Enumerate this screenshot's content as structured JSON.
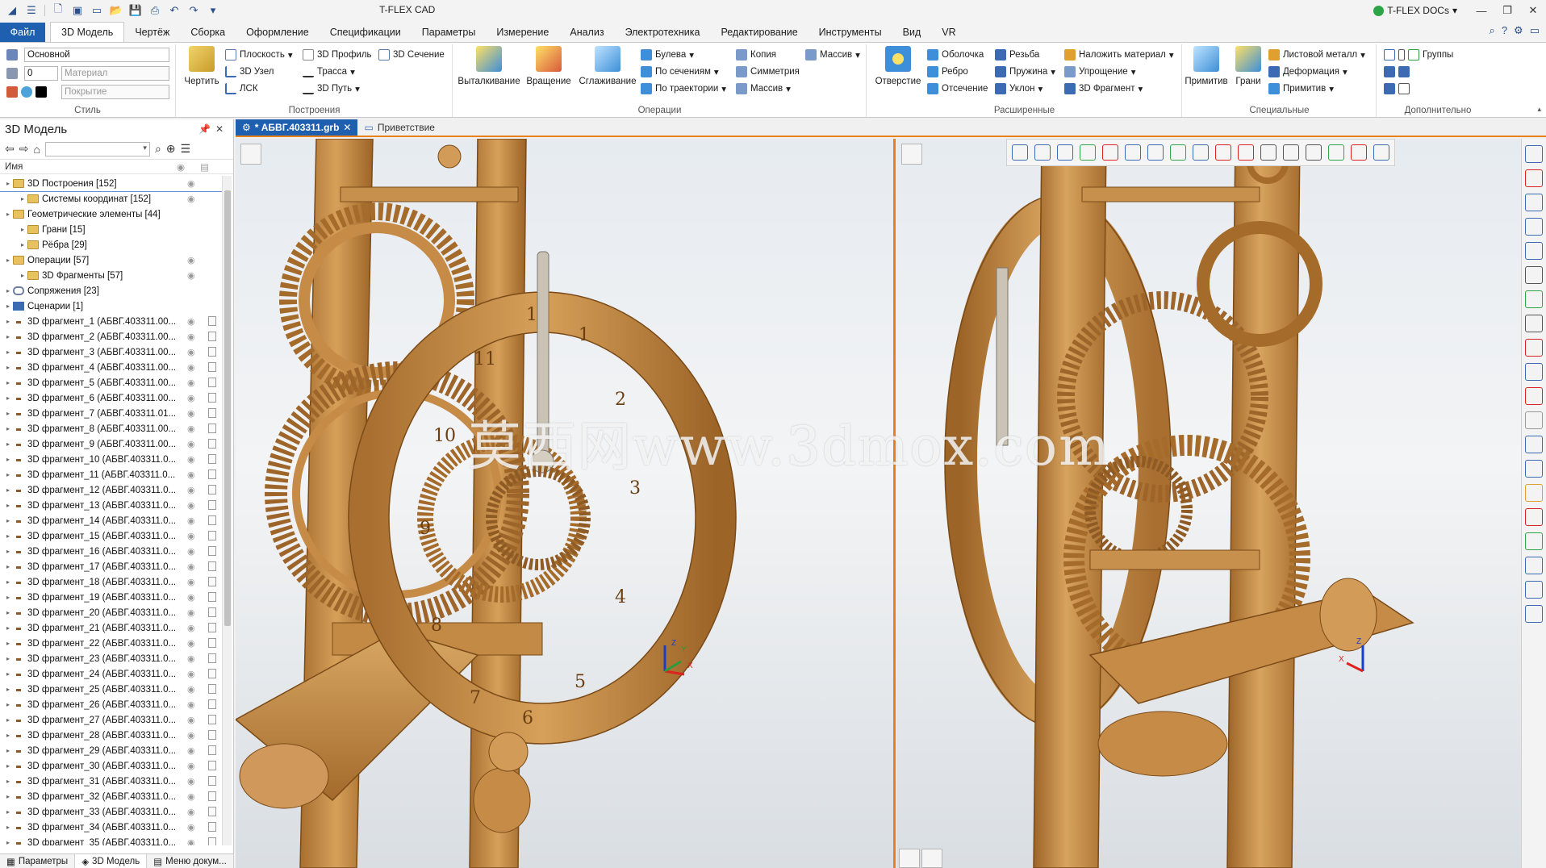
{
  "app": {
    "title": "T-FLEX CAD",
    "docs_label": "T-FLEX DOCs",
    "window_buttons": [
      "—",
      "❐",
      "✕"
    ]
  },
  "tabs": {
    "file": "Файл",
    "items": [
      "3D Модель",
      "Чертёж",
      "Сборка",
      "Оформление",
      "Спецификации",
      "Параметры",
      "Измерение",
      "Анализ",
      "Электротехника",
      "Редактирование",
      "Инструменты",
      "Вид",
      "VR"
    ]
  },
  "ribbon": {
    "style": {
      "label": "Стиль",
      "layer": "Основной",
      "level": "0",
      "material_placeholder": "Материал",
      "coating_placeholder": "Покрытие"
    },
    "build": {
      "label": "Построения",
      "draw": "Чертить",
      "plane": "Плоскость",
      "node3d": "3D Узел",
      "lsk": "ЛСК",
      "profile3d": "3D Профиль",
      "trace": "Трасса",
      "path3d": "3D Путь",
      "section3d": "3D Сечение"
    },
    "operations": {
      "label": "Операции",
      "extrude": "Выталкивание",
      "revolve": "Вращение",
      "smooth": "Сглаживание",
      "boolean": "Булева",
      "by_sections": "По сечениям",
      "by_trajectory": "По траектории",
      "copy": "Копия",
      "symmetry": "Симметрия",
      "array": "Массив",
      "array2": "Массив"
    },
    "advanced": {
      "label": "Расширенные",
      "hole": "Отверстие",
      "shell": "Оболочка",
      "rib": "Ребро",
      "cut": "Отсечение",
      "thread": "Резьба",
      "spring": "Пружина",
      "draft": "Уклон",
      "apply_material": "Наложить материал",
      "simplify": "Упрощение",
      "fragment3d": "3D Фрагмент"
    },
    "special": {
      "label": "Специальные",
      "primitive": "Примитив",
      "faces": "Грани",
      "sheet_metal": "Листовой металл",
      "deform": "Деформация",
      "primitive2": "Примитив"
    },
    "extra": {
      "label": "Дополнительно",
      "groups": "Группы"
    }
  },
  "left_panel": {
    "title": "3D Модель",
    "column_name": "Имя",
    "tree": [
      {
        "label": "3D Построения [152]",
        "level": 0,
        "icon": "folder",
        "eye": true,
        "selected": true
      },
      {
        "label": "Системы координат [152]",
        "level": 1,
        "icon": "folder",
        "eye": true
      },
      {
        "label": "Геометрические элементы [44]",
        "level": 0,
        "icon": "folder",
        "eye": false
      },
      {
        "label": "Грани [15]",
        "level": 1,
        "icon": "folder",
        "eye": false
      },
      {
        "label": "Рёбра [29]",
        "level": 1,
        "icon": "folder",
        "eye": false
      },
      {
        "label": "Операции [57]",
        "level": 0,
        "icon": "folder",
        "eye": true
      },
      {
        "label": "3D Фрагменты [57]",
        "level": 1,
        "icon": "folder",
        "eye": true
      },
      {
        "label": "Сопряжения [23]",
        "level": 0,
        "icon": "chain",
        "eye": false
      },
      {
        "label": "Сценарии [1]",
        "level": 0,
        "icon": "grid",
        "eye": false
      },
      {
        "label": "3D фрагмент_1 (АБВГ.403311.00...",
        "level": 0,
        "icon": "frag",
        "eye": true
      },
      {
        "label": "3D фрагмент_2 (АБВГ.403311.00...",
        "level": 0,
        "icon": "frag",
        "eye": true
      },
      {
        "label": "3D фрагмент_3 (АБВГ.403311.00...",
        "level": 0,
        "icon": "frag",
        "eye": true
      },
      {
        "label": "3D фрагмент_4 (АБВГ.403311.00...",
        "level": 0,
        "icon": "frag",
        "eye": true
      },
      {
        "label": "3D фрагмент_5 (АБВГ.403311.00...",
        "level": 0,
        "icon": "frag",
        "eye": true
      },
      {
        "label": "3D фрагмент_6 (АБВГ.403311.00...",
        "level": 0,
        "icon": "frag",
        "eye": true
      },
      {
        "label": "3D фрагмент_7 (АБВГ.403311.01...",
        "level": 0,
        "icon": "frag",
        "eye": true
      },
      {
        "label": "3D фрагмент_8 (АБВГ.403311.00...",
        "level": 0,
        "icon": "frag",
        "eye": true
      },
      {
        "label": "3D фрагмент_9 (АБВГ.403311.00...",
        "level": 0,
        "icon": "frag",
        "eye": true
      },
      {
        "label": "3D фрагмент_10 (АБВГ.403311.0...",
        "level": 0,
        "icon": "frag",
        "eye": true
      },
      {
        "label": "3D фрагмент_11 (АБВГ.403311.0...",
        "level": 0,
        "icon": "frag",
        "eye": true
      },
      {
        "label": "3D фрагмент_12 (АБВГ.403311.0...",
        "level": 0,
        "icon": "frag",
        "eye": true
      },
      {
        "label": "3D фрагмент_13 (АБВГ.403311.0...",
        "level": 0,
        "icon": "frag",
        "eye": true
      },
      {
        "label": "3D фрагмент_14 (АБВГ.403311.0...",
        "level": 0,
        "icon": "frag",
        "eye": true
      },
      {
        "label": "3D фрагмент_15 (АБВГ.403311.0...",
        "level": 0,
        "icon": "frag",
        "eye": true
      },
      {
        "label": "3D фрагмент_16 (АБВГ.403311.0...",
        "level": 0,
        "icon": "frag",
        "eye": true
      },
      {
        "label": "3D фрагмент_17 (АБВГ.403311.0...",
        "level": 0,
        "icon": "frag",
        "eye": true
      },
      {
        "label": "3D фрагмент_18 (АБВГ.403311.0...",
        "level": 0,
        "icon": "frag",
        "eye": true
      },
      {
        "label": "3D фрагмент_19 (АБВГ.403311.0...",
        "level": 0,
        "icon": "frag",
        "eye": true
      },
      {
        "label": "3D фрагмент_20 (АБВГ.403311.0...",
        "level": 0,
        "icon": "frag",
        "eye": true
      },
      {
        "label": "3D фрагмент_21 (АБВГ.403311.0...",
        "level": 0,
        "icon": "frag",
        "eye": true
      },
      {
        "label": "3D фрагмент_22 (АБВГ.403311.0...",
        "level": 0,
        "icon": "frag",
        "eye": true
      },
      {
        "label": "3D фрагмент_23 (АБВГ.403311.0...",
        "level": 0,
        "icon": "frag",
        "eye": true
      },
      {
        "label": "3D фрагмент_24 (АБВГ.403311.0...",
        "level": 0,
        "icon": "frag",
        "eye": true
      },
      {
        "label": "3D фрагмент_25 (АБВГ.403311.0...",
        "level": 0,
        "icon": "frag",
        "eye": true
      },
      {
        "label": "3D фрагмент_26 (АБВГ.403311.0...",
        "level": 0,
        "icon": "frag",
        "eye": true
      },
      {
        "label": "3D фрагмент_27 (АБВГ.403311.0...",
        "level": 0,
        "icon": "frag",
        "eye": true
      },
      {
        "label": "3D фрагмент_28 (АБВГ.403311.0...",
        "level": 0,
        "icon": "frag",
        "eye": true
      },
      {
        "label": "3D фрагмент_29 (АБВГ.403311.0...",
        "level": 0,
        "icon": "frag",
        "eye": true
      },
      {
        "label": "3D фрагмент_30 (АБВГ.403311.0...",
        "level": 0,
        "icon": "frag",
        "eye": true
      },
      {
        "label": "3D фрагмент_31 (АБВГ.403311.0...",
        "level": 0,
        "icon": "frag",
        "eye": true
      },
      {
        "label": "3D фрагмент_32 (АБВГ.403311.0...",
        "level": 0,
        "icon": "frag",
        "eye": true
      },
      {
        "label": "3D фрагмент_33 (АБВГ.403311.0...",
        "level": 0,
        "icon": "frag",
        "eye": true
      },
      {
        "label": "3D фрагмент_34 (АБВГ.403311.0...",
        "level": 0,
        "icon": "frag",
        "eye": true
      },
      {
        "label": "3D фрагмент_35 (АБВГ.403311.0...",
        "level": 0,
        "icon": "frag",
        "eye": true
      }
    ],
    "bottom_tabs": [
      "Параметры",
      "3D Модель",
      "Меню докум..."
    ]
  },
  "doc_tabs": {
    "active": "* АБВГ.403311.grb",
    "other": "Приветствие"
  },
  "viewport": {
    "watermark": "莫西网www.3dmox.com",
    "clock_numbers": [
      "12",
      "1",
      "2",
      "3",
      "4",
      "5",
      "6",
      "7",
      "8",
      "9",
      "10",
      "11"
    ],
    "axis_left": {
      "z": "Z",
      "y": "Y",
      "x": "X"
    },
    "axis_right": {
      "z": "Z",
      "x": "X"
    }
  },
  "colors": {
    "accent": "#1e5fb0",
    "orange_frame": "#e8801c",
    "wood": "#c48b45",
    "wood_dark": "#8f5b24",
    "wood_light": "#dba965"
  }
}
